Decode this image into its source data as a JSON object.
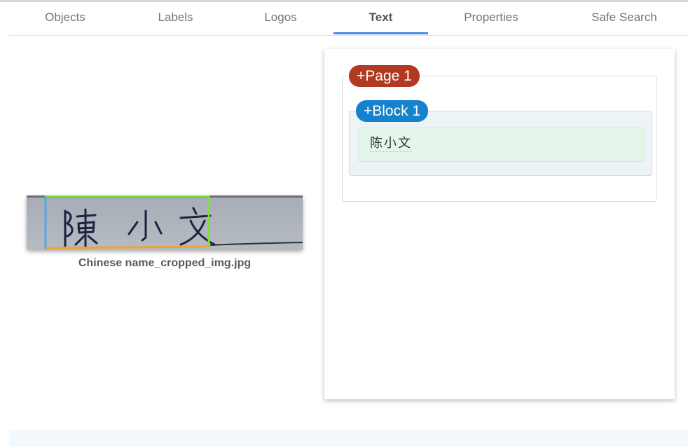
{
  "tabs": [
    {
      "label": "Objects"
    },
    {
      "label": "Labels"
    },
    {
      "label": "Logos"
    },
    {
      "label": "Text"
    },
    {
      "label": "Properties"
    },
    {
      "label": "Safe Search"
    }
  ],
  "active_tab": "Text",
  "image": {
    "filename": "Chinese name_cropped_img.jpg",
    "handwritten_text": "陳 小 文"
  },
  "results": {
    "page_label": "+Page 1",
    "block_label": "+Block 1",
    "paragraph_text": "陈小文"
  },
  "colors": {
    "page_chip": "#b23a22",
    "block_chip": "#1482cc",
    "tab_indicator": "#4a8ae4",
    "paragraph_bg": "#e6f5e9",
    "block_bg": "#edf4f8"
  }
}
